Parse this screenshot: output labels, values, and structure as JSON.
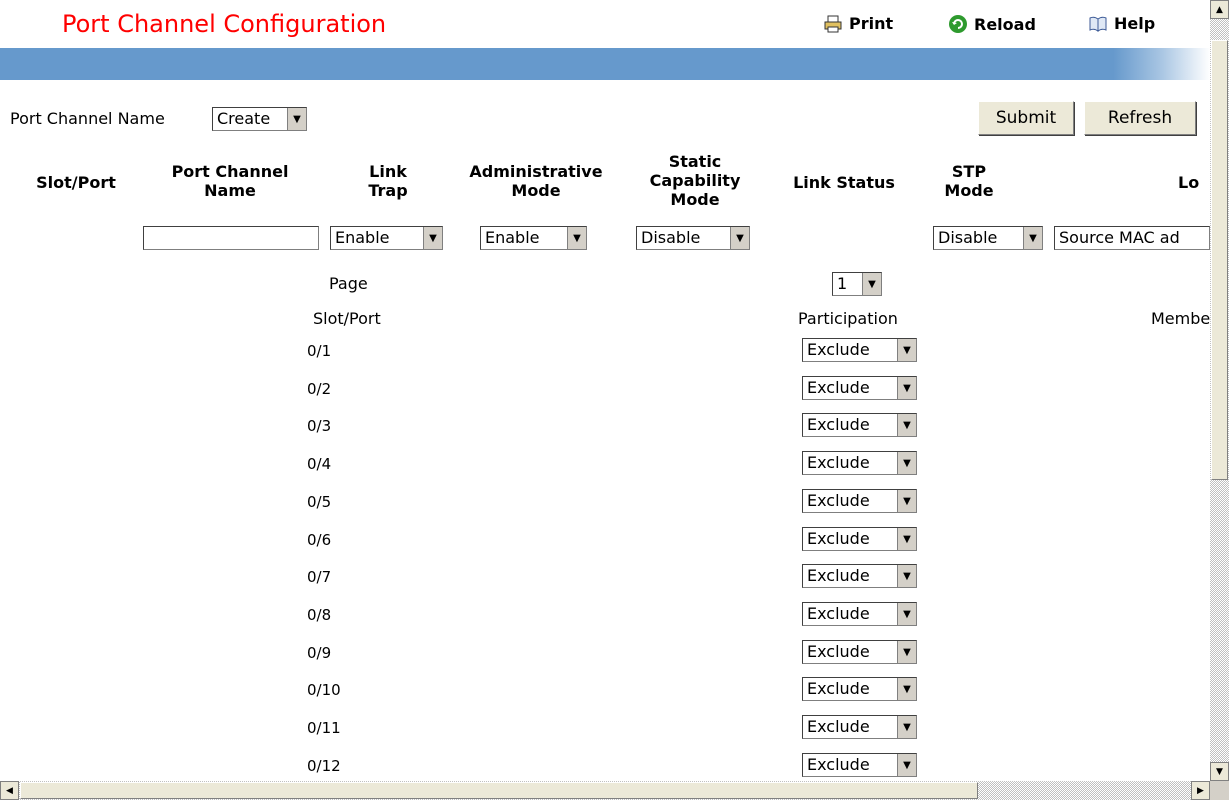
{
  "header": {
    "title": "Port Channel Configuration",
    "print_label": "Print",
    "reload_label": "Reload",
    "help_label": "Help"
  },
  "form": {
    "port_channel_name_label": "Port Channel Name",
    "port_channel_name_value": "Create",
    "submit_label": "Submit",
    "refresh_label": "Refresh"
  },
  "table": {
    "headers": {
      "slot_port": "Slot/Port",
      "port_channel_name": "Port Channel Name",
      "link_trap": "Link Trap",
      "admin_mode": "Administrative Mode",
      "static_mode": "Static Capability Mode",
      "link_status": "Link Status",
      "stp_mode": "STP Mode",
      "load_balance": "Lo"
    },
    "inputs": {
      "name_value": "",
      "link_trap": "Enable",
      "admin_mode": "Enable",
      "static_mode": "Disable",
      "stp_mode": "Disable",
      "load_balance": "Source MAC ad"
    }
  },
  "members": {
    "page_label": "Page",
    "page_value": "1",
    "slot_port_header": "Slot/Port",
    "participation_header": "Participation",
    "member_header": "Membe",
    "rows": [
      {
        "port": "0/1",
        "participation": "Exclude"
      },
      {
        "port": "0/2",
        "participation": "Exclude"
      },
      {
        "port": "0/3",
        "participation": "Exclude"
      },
      {
        "port": "0/4",
        "participation": "Exclude"
      },
      {
        "port": "0/5",
        "participation": "Exclude"
      },
      {
        "port": "0/6",
        "participation": "Exclude"
      },
      {
        "port": "0/7",
        "participation": "Exclude"
      },
      {
        "port": "0/8",
        "participation": "Exclude"
      },
      {
        "port": "0/9",
        "participation": "Exclude"
      },
      {
        "port": "0/10",
        "participation": "Exclude"
      },
      {
        "port": "0/11",
        "participation": "Exclude"
      },
      {
        "port": "0/12",
        "participation": "Exclude"
      }
    ]
  },
  "icons": {
    "print": "printer-icon",
    "reload": "reload-icon",
    "help": "book-icon",
    "dropdown": "chevron-down-icon"
  },
  "colors": {
    "title": "#ff0000",
    "band": "#6699cc",
    "reload_icon": "#2e9a2e"
  }
}
